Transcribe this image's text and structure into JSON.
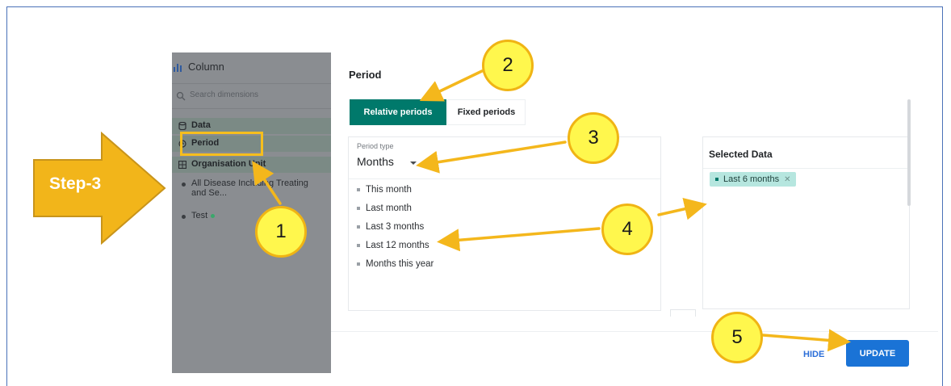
{
  "overlay": {
    "step_label": "Step-3",
    "badges": [
      "1",
      "2",
      "3",
      "4",
      "5"
    ]
  },
  "sidebar": {
    "chart_type_label": "Column",
    "search_placeholder": "Search dimensions",
    "data_header": "Data",
    "period_header": "Period",
    "org_unit_header": "Organisation Unit",
    "items": [
      {
        "label": "All Disease Including Treating and Se..."
      },
      {
        "label": "Test"
      }
    ]
  },
  "dialog": {
    "title": "Period",
    "tabs": [
      {
        "label": "Relative periods",
        "active": true
      },
      {
        "label": "Fixed periods",
        "active": false
      }
    ],
    "period_type_label": "Period type",
    "period_type_value": "Months",
    "options": [
      "This month",
      "Last month",
      "Last 3 months",
      "Last 12 months",
      "Months this year"
    ],
    "selected_title": "Selected Data",
    "selected_items": [
      {
        "label": "Last 6 months"
      }
    ],
    "hide_label": "HIDE",
    "update_label": "UPDATE"
  },
  "colors": {
    "accent_teal": "#00796b",
    "chip_bg": "#b6e6df",
    "update_blue": "#1a73d6",
    "annotation_yellow": "#fff74d",
    "annotation_orange": "#f6be1d",
    "step_arrow": "#f2b51a"
  }
}
